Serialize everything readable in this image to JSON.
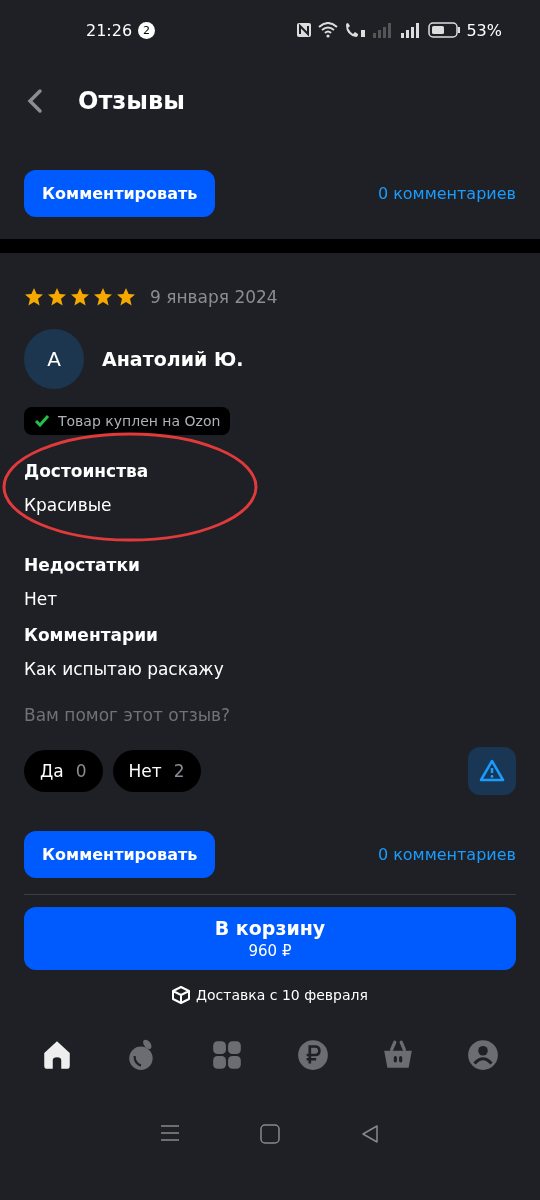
{
  "status_bar": {
    "time": "21:26",
    "notification_count": "2",
    "battery": "53%"
  },
  "header": {
    "title": "Отзывы"
  },
  "top_actions": {
    "button": "Комментировать",
    "comments_link": "0 комментариев"
  },
  "review": {
    "stars": 5,
    "date": "9 января 2024",
    "avatar_letter": "А",
    "author": "Анатолий Ю.",
    "badge": "Товар куплен на Ozon",
    "sections": [
      {
        "heading": "Достоинства",
        "text": "Красивые"
      },
      {
        "heading": "Недостатки",
        "text": "Нет"
      },
      {
        "heading": "Комментарии",
        "text": "Как испытаю раскажу"
      }
    ],
    "helpful_question": "Вам помог этот отзыв?",
    "votes": [
      {
        "label": "Да",
        "count": "0"
      },
      {
        "label": "Нет",
        "count": "2"
      }
    ],
    "button": "Комментировать",
    "comments_link": "0 комментариев"
  },
  "cart": {
    "button": "В корзину",
    "price": "960 ₽",
    "delivery": "Доставка с 10 февраля"
  },
  "bottom_nav": [
    {
      "kind": "home",
      "selected": true
    },
    {
      "kind": "fresh",
      "selected": false
    },
    {
      "kind": "catalog",
      "selected": false
    },
    {
      "kind": "finance",
      "selected": false
    },
    {
      "kind": "cart",
      "selected": false
    },
    {
      "kind": "profile",
      "selected": false
    }
  ]
}
